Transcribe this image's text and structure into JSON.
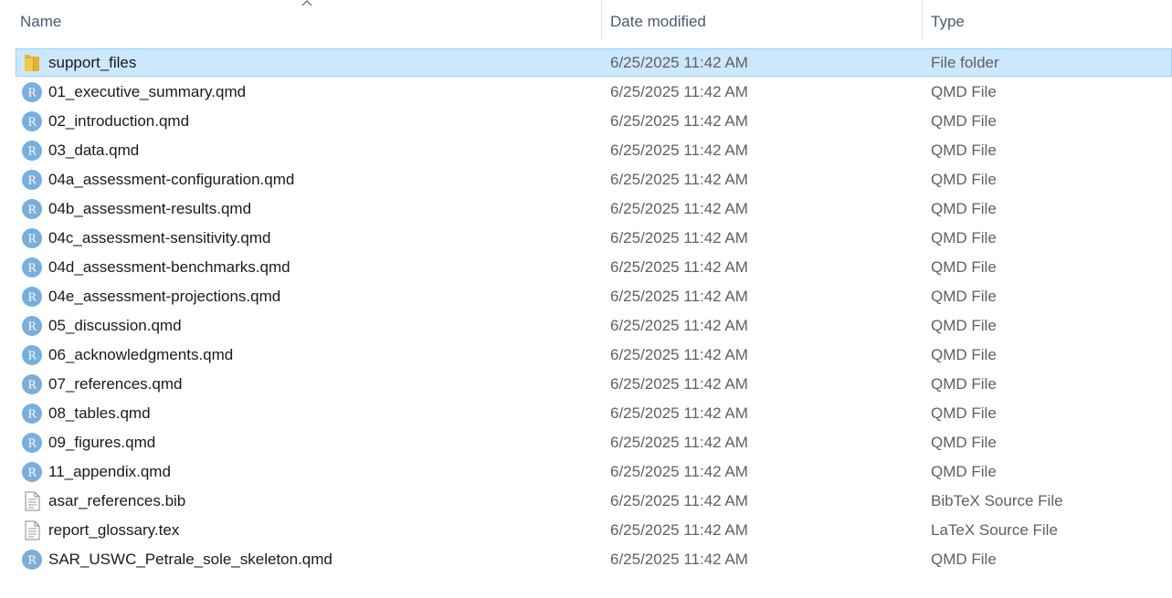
{
  "columns": {
    "name": "Name",
    "date": "Date modified",
    "type": "Type"
  },
  "sort": {
    "column": "name",
    "direction": "ascending",
    "icon": "chevron-up-icon"
  },
  "colors": {
    "selection_bg": "#cce8ff",
    "selection_border": "#99d1ff",
    "r_icon": "#7aaedc",
    "folder": "#f2c94c"
  },
  "files": [
    {
      "name": "support_files",
      "date": "6/25/2025 11:42 AM",
      "type": "File folder",
      "icon": "folder-icon",
      "selected": true
    },
    {
      "name": "01_executive_summary.qmd",
      "date": "6/25/2025 11:42 AM",
      "type": "QMD File",
      "icon": "r-file-icon"
    },
    {
      "name": "02_introduction.qmd",
      "date": "6/25/2025 11:42 AM",
      "type": "QMD File",
      "icon": "r-file-icon"
    },
    {
      "name": "03_data.qmd",
      "date": "6/25/2025 11:42 AM",
      "type": "QMD File",
      "icon": "r-file-icon"
    },
    {
      "name": "04a_assessment-configuration.qmd",
      "date": "6/25/2025 11:42 AM",
      "type": "QMD File",
      "icon": "r-file-icon"
    },
    {
      "name": "04b_assessment-results.qmd",
      "date": "6/25/2025 11:42 AM",
      "type": "QMD File",
      "icon": "r-file-icon"
    },
    {
      "name": "04c_assessment-sensitivity.qmd",
      "date": "6/25/2025 11:42 AM",
      "type": "QMD File",
      "icon": "r-file-icon"
    },
    {
      "name": "04d_assessment-benchmarks.qmd",
      "date": "6/25/2025 11:42 AM",
      "type": "QMD File",
      "icon": "r-file-icon"
    },
    {
      "name": "04e_assessment-projections.qmd",
      "date": "6/25/2025 11:42 AM",
      "type": "QMD File",
      "icon": "r-file-icon"
    },
    {
      "name": "05_discussion.qmd",
      "date": "6/25/2025 11:42 AM",
      "type": "QMD File",
      "icon": "r-file-icon"
    },
    {
      "name": "06_acknowledgments.qmd",
      "date": "6/25/2025 11:42 AM",
      "type": "QMD File",
      "icon": "r-file-icon"
    },
    {
      "name": "07_references.qmd",
      "date": "6/25/2025 11:42 AM",
      "type": "QMD File",
      "icon": "r-file-icon"
    },
    {
      "name": "08_tables.qmd",
      "date": "6/25/2025 11:42 AM",
      "type": "QMD File",
      "icon": "r-file-icon"
    },
    {
      "name": "09_figures.qmd",
      "date": "6/25/2025 11:42 AM",
      "type": "QMD File",
      "icon": "r-file-icon"
    },
    {
      "name": "11_appendix.qmd",
      "date": "6/25/2025 11:42 AM",
      "type": "QMD File",
      "icon": "r-file-icon"
    },
    {
      "name": "asar_references.bib",
      "date": "6/25/2025 11:42 AM",
      "type": "BibTeX Source File",
      "icon": "text-file-icon"
    },
    {
      "name": "report_glossary.tex",
      "date": "6/25/2025 11:42 AM",
      "type": "LaTeX Source File",
      "icon": "text-file-icon"
    },
    {
      "name": "SAR_USWC_Petrale_sole_skeleton.qmd",
      "date": "6/25/2025 11:42 AM",
      "type": "QMD File",
      "icon": "r-file-icon"
    }
  ]
}
